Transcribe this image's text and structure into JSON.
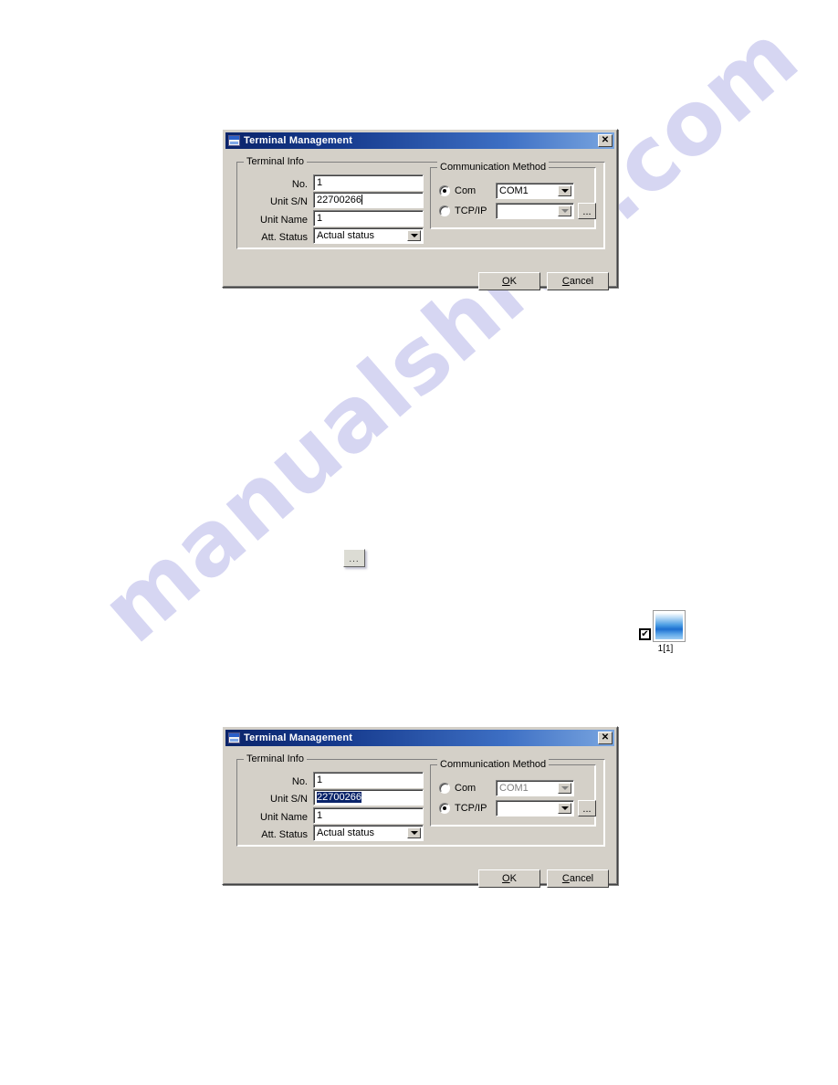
{
  "page": {
    "watermark_text": "manualshive.com",
    "watermark_color": "#d6d6f2",
    "background_color": "#ffffff"
  },
  "dialog_common": {
    "title": "Terminal Management",
    "close_label": "✕",
    "title_icon": "window-icon",
    "groups": {
      "terminal_info": "Terminal Info",
      "communication_method": "Communication Method"
    },
    "labels": {
      "no": "No.",
      "unit_sn": "Unit S/N",
      "unit_name": "Unit Name",
      "att_status": "Att. Status",
      "com": "Com",
      "tcpip": "TCP/IP"
    },
    "buttons": {
      "ok_accel": "O",
      "ok_rest": "K",
      "cancel_accel": "C",
      "cancel_rest": "ancel",
      "browse": "..."
    }
  },
  "dialog_top": {
    "fields": {
      "no": "1",
      "unit_sn": "22700266",
      "unit_name": "1",
      "att_status": "Actual status"
    },
    "communication": {
      "selected": "Com",
      "com_radio_checked": true,
      "tcpip_radio_checked": false,
      "com_port": "COM1",
      "com_port_enabled": true,
      "tcpip_value": "",
      "tcpip_enabled": false
    }
  },
  "dialog_bottom": {
    "fields": {
      "no": "1",
      "unit_sn": "22700266",
      "unit_sn_selected": true,
      "unit_name": "1",
      "att_status": "Actual status"
    },
    "communication": {
      "selected": "TCP/IP",
      "com_radio_checked": false,
      "tcpip_radio_checked": true,
      "com_port": "COM1",
      "com_port_enabled": false,
      "tcpip_value": "",
      "tcpip_enabled": true
    }
  },
  "callout_button": {
    "label": "...",
    "name": "browse-ellipsis-button"
  },
  "thumbnail": {
    "label": "1[1]",
    "checkbox_glyph": "✔",
    "checked": true
  }
}
